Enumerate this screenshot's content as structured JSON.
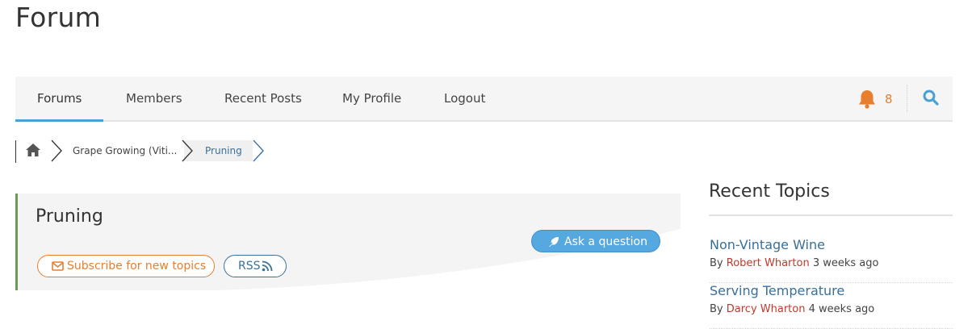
{
  "header": {
    "title": "Forum"
  },
  "nav": {
    "items": [
      {
        "label": "Forums",
        "active": true
      },
      {
        "label": "Members"
      },
      {
        "label": "Recent Posts"
      },
      {
        "label": "My Profile"
      },
      {
        "label": "Logout"
      }
    ],
    "notifications": {
      "icon": "bell-icon",
      "count": "8",
      "color": "#e77f2f"
    },
    "search": {
      "icon": "search-icon",
      "color": "#4a9fd6"
    }
  },
  "breadcrumb": {
    "home_icon": "home-icon",
    "items": [
      {
        "label": "Grape Growing (Viti..."
      },
      {
        "label": "Pruning",
        "current": true
      }
    ]
  },
  "forum": {
    "title": "Pruning",
    "ask_button": "Ask a question",
    "subscribe_button": "Subscribe for new topics",
    "rss_button": "RSS",
    "accent_color": "#6a9a5a"
  },
  "sidebar": {
    "title": "Recent Topics",
    "by_prefix": "By",
    "topics": [
      {
        "title": "Non-Vintage Wine",
        "author": "Robert Wharton",
        "time": "3 weeks ago"
      },
      {
        "title": "Serving Temperature",
        "author": "Darcy Wharton",
        "time": "4 weeks ago"
      }
    ]
  }
}
